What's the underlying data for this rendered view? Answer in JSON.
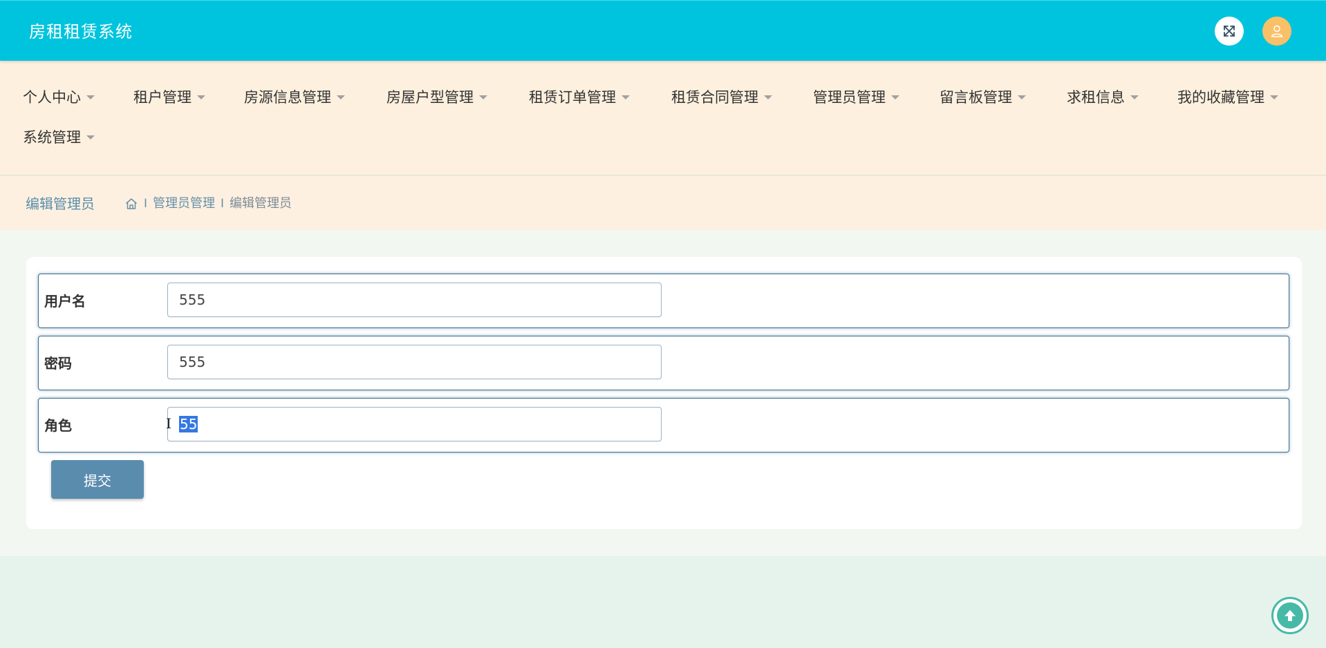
{
  "app": {
    "title": "房租租赁系统"
  },
  "header": {
    "fullscreen_icon": "expand-arrows-icon",
    "avatar_icon": "user-icon"
  },
  "nav": {
    "items": [
      {
        "label": "个人中心"
      },
      {
        "label": "租户管理"
      },
      {
        "label": "房源信息管理"
      },
      {
        "label": "房屋户型管理"
      },
      {
        "label": "租赁订单管理"
      },
      {
        "label": "租赁合同管理"
      },
      {
        "label": "管理员管理"
      },
      {
        "label": "留言板管理"
      },
      {
        "label": "求租信息"
      },
      {
        "label": "我的收藏管理"
      },
      {
        "label": "系统管理"
      }
    ]
  },
  "breadcrumb": {
    "page_title": "编辑管理员",
    "home_icon": "home-icon",
    "separator": "I",
    "items": [
      "管理员管理",
      "编辑管理员"
    ]
  },
  "form": {
    "fields": [
      {
        "label": "用户名",
        "value": "555"
      },
      {
        "label": "密码",
        "value": "555"
      },
      {
        "label": "角色",
        "value": "55",
        "value_selected": true
      }
    ],
    "submit_label": "提交"
  },
  "scroll_top": {
    "icon": "arrow-up-icon"
  },
  "colors": {
    "header_bg": "#00c4dd",
    "nav_bg": "#fdf0de",
    "accent": "#5a8cae",
    "scroll_btn": "#47b9a7",
    "avatar_bg": "#f9c068"
  }
}
